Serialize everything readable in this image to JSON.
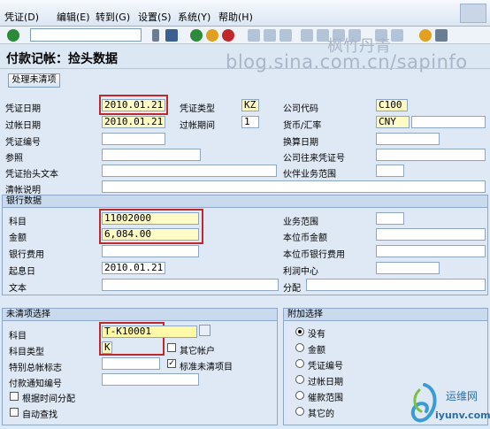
{
  "menu": [
    "凭证(D)",
    "编辑(E)",
    "转到(G)",
    "设置(S)",
    "系统(Y)",
    "帮助(H)"
  ],
  "title": "付款记帐：捡头数据",
  "watermark": {
    "line1": "枫竹丹青",
    "line2": "blog.sina.com.cn/sapinfo"
  },
  "button": "处理未清项",
  "header": {
    "doc_date": {
      "label": "凭证日期",
      "value": "2010.01.21"
    },
    "doc_type": {
      "label": "凭证类型",
      "value": "KZ"
    },
    "company_code": {
      "label": "公司代码",
      "value": "C100"
    },
    "posting_date": {
      "label": "过帐日期",
      "value": "2010.01.21"
    },
    "period": {
      "label": "过帐期间",
      "value": "1"
    },
    "currency": {
      "label": "货币/汇率",
      "value": "CNY"
    },
    "doc_number": {
      "label": "凭证编号"
    },
    "translation_date": {
      "label": "换算日期"
    },
    "reference": {
      "label": "参照"
    },
    "cross_cc": {
      "label": "公司往来凭证号"
    },
    "header_text": {
      "label": "凭证抬头文本"
    },
    "partner_ba": {
      "label": "伙伴业务范围"
    },
    "clearing_text": {
      "label": "清帐说明"
    }
  },
  "bank": {
    "title": "银行数据",
    "account": {
      "label": "科目",
      "value": "11002000"
    },
    "amount": {
      "label": "金额",
      "value": "6,084.00"
    },
    "charges": {
      "label": "银行费用"
    },
    "value_date": {
      "label": "起息日",
      "value": "2010.01.21"
    },
    "text": {
      "label": "文本"
    },
    "business_area": {
      "label": "业务范围"
    },
    "lc_amount": {
      "label": "本位币金额"
    },
    "lc_charges": {
      "label": "本位币银行费用"
    },
    "profit_center": {
      "label": "利润中心"
    },
    "assignment": {
      "label": "分配"
    }
  },
  "open_items": {
    "title": "未清项选择",
    "account": {
      "label": "科目",
      "value": "T-K10001"
    },
    "account_type": {
      "label": "科目类型",
      "value": "K"
    },
    "other_accounts": "其它帐户",
    "sgl_indicator": {
      "label": "特别总帐标志"
    },
    "standard_oi": "标准未清项目",
    "payment_advice": {
      "label": "付款通知编号"
    },
    "by_age": "根据时间分配",
    "auto_search": "自动查找"
  },
  "additional": {
    "title": "附加选择",
    "options": [
      "没有",
      "金额",
      "凭证编号",
      "过帐日期",
      "催款范围",
      "其它的"
    ],
    "selected": 0
  },
  "logo": {
    "cn": "运维网",
    "url": "iyunv.com"
  },
  "colors": {
    "accent_red": "#c0292b",
    "section_head": "#c9d9ee",
    "background": "#dfe9f5"
  }
}
